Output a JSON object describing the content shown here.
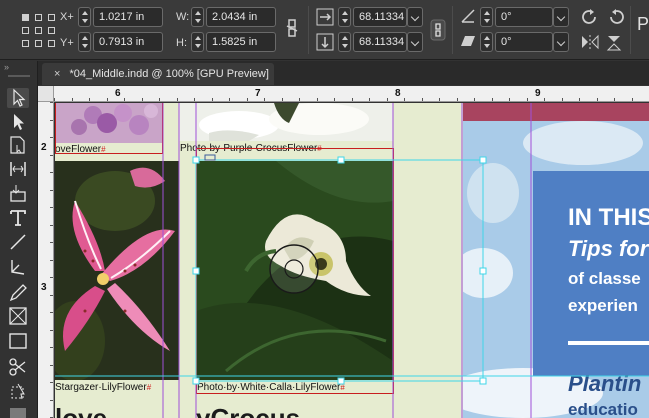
{
  "control_bar": {
    "x_label": "X+",
    "y_label": "Y+",
    "w_label": "W:",
    "h_label": "H:",
    "x_value": "1.0217 in",
    "y_value": "0.7913 in",
    "w_value": "2.0434 in",
    "h_value": "1.5825 in",
    "scale_x_value": "68.11334",
    "scale_y_value": "68.11334",
    "rotate_value": "0°",
    "shear_value": "0°",
    "partial_glyph": "P"
  },
  "tab": {
    "close_glyph": "×",
    "title": "*04_Middle.indd @ 100% [GPU Preview]"
  },
  "ruler": {
    "h_labels": [
      "6",
      "7",
      "8",
      "9"
    ],
    "v_labels": [
      "2",
      "3"
    ]
  },
  "canvas": {
    "caption_foxglove": "oveFlower",
    "caption_crocus": "Photo·by·Purple·CrocusFlower",
    "caption_lily": "Stargazer·LilyFlower",
    "caption_calla": "Photo·by·White·Calla·LilyFlower",
    "pilcrow": "#",
    "bottom_word_left": "love",
    "bottom_word_right": "yCrocus",
    "headline": "IN THIS",
    "subhead": "Tips for",
    "line1": "of classe",
    "line2": "experien",
    "planting": "Plantin",
    "education": "educatio"
  },
  "colors": {
    "canvas_bg": "#e6ecd0",
    "panel_blue": "#4f7fc4",
    "maroon_band": "#a8445f",
    "frame_cyan": "#3fd6e8",
    "column_purple": "#a050d8",
    "frame_red": "#c81e1e"
  }
}
